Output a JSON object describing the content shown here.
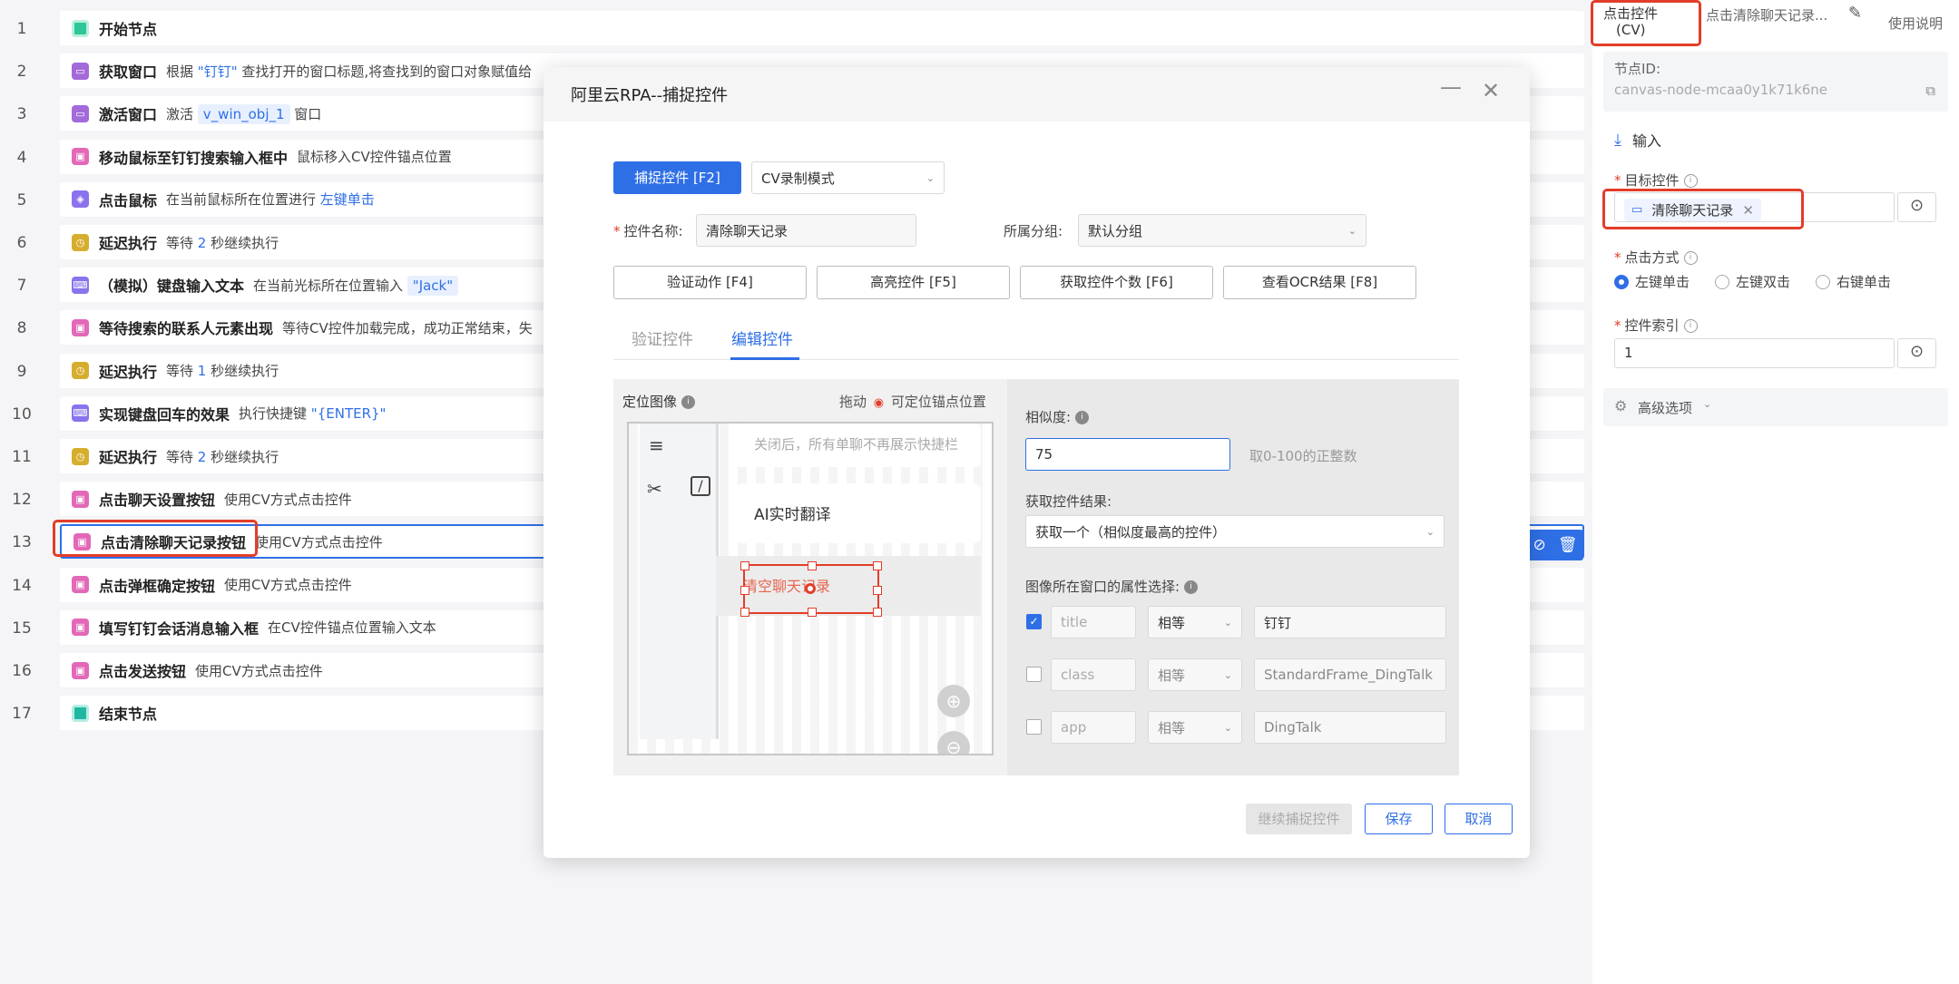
{
  "flow": {
    "steps": [
      {
        "num": "1",
        "icon": "start-node-icon",
        "title": "开始节点",
        "desc": []
      },
      {
        "num": "2",
        "icon": "window-icon",
        "title": "获取窗口",
        "desc": [
          {
            "t": "根据 "
          },
          {
            "t": "\"钉钉\"",
            "c": "hl"
          },
          {
            "t": " 查找打开的窗口标题,将查找到的窗口对象赋值给"
          }
        ]
      },
      {
        "num": "3",
        "icon": "window-icon",
        "title": "激活窗口",
        "desc": [
          {
            "t": "激活 "
          },
          {
            "t": "v_win_obj_1",
            "c": "tag"
          },
          {
            "t": " 窗口"
          }
        ]
      },
      {
        "num": "4",
        "icon": "image-icon",
        "title": "移动鼠标至钉钉搜索输入框中",
        "desc": [
          {
            "t": "鼠标移入CV控件锚点位置"
          }
        ]
      },
      {
        "num": "5",
        "icon": "mouse-icon",
        "title": "点击鼠标",
        "desc": [
          {
            "t": "在当前鼠标所在位置进行 "
          },
          {
            "t": "左键单击",
            "c": "hl"
          }
        ]
      },
      {
        "num": "6",
        "icon": "delay-icon",
        "title": "延迟执行",
        "desc": [
          {
            "t": "等待 "
          },
          {
            "t": "2",
            "c": "hl"
          },
          {
            "t": " 秒继续执行"
          }
        ]
      },
      {
        "num": "7",
        "icon": "keyboard-icon",
        "title": "（模拟）键盘输入文本",
        "desc": [
          {
            "t": "在当前光标所在位置输入 "
          },
          {
            "t": "\"Jack\"",
            "c": "tag"
          }
        ]
      },
      {
        "num": "8",
        "icon": "image-icon",
        "title": "等待搜索的联系人元素出现",
        "desc": [
          {
            "t": "等待CV控件加载完成，成功正常结束，失"
          }
        ]
      },
      {
        "num": "9",
        "icon": "delay-icon",
        "title": "延迟执行",
        "desc": [
          {
            "t": "等待 "
          },
          {
            "t": "1",
            "c": "hl"
          },
          {
            "t": " 秒继续执行"
          }
        ]
      },
      {
        "num": "10",
        "icon": "keyboard-icon",
        "title": "实现键盘回车的效果",
        "desc": [
          {
            "t": "执行快捷键 "
          },
          {
            "t": "\"{ENTER}\"",
            "c": "hl"
          }
        ]
      },
      {
        "num": "11",
        "icon": "delay-icon",
        "title": "延迟执行",
        "desc": [
          {
            "t": "等待 "
          },
          {
            "t": "2",
            "c": "hl"
          },
          {
            "t": " 秒继续执行"
          }
        ]
      },
      {
        "num": "12",
        "icon": "image-icon",
        "title": "点击聊天设置按钮",
        "desc": [
          {
            "t": "使用CV方式点击控件"
          }
        ]
      },
      {
        "num": "13",
        "icon": "image-icon",
        "title": "点击清除聊天记录按钮",
        "desc": [
          {
            "t": "使用CV方式点击控件"
          }
        ],
        "selected": true
      },
      {
        "num": "14",
        "icon": "image-icon",
        "title": "点击弹框确定按钮",
        "desc": [
          {
            "t": "使用CV方式点击控件"
          }
        ]
      },
      {
        "num": "15",
        "icon": "image-icon",
        "title": "填写钉钉会话消息输入框",
        "desc": [
          {
            "t": "在CV控件锚点位置输入文本"
          }
        ]
      },
      {
        "num": "16",
        "icon": "image-icon",
        "title": "点击发送按钮",
        "desc": [
          {
            "t": "使用CV方式点击控件"
          }
        ]
      },
      {
        "num": "17",
        "icon": "end-node-icon",
        "title": "结束节点",
        "desc": []
      }
    ]
  },
  "panel": {
    "tab_cv": "点击控件",
    "tab_cv2": "(CV)",
    "tab_name": "点击清除聊天记录...",
    "help": "使用说明",
    "node_id_label": "节点ID:",
    "node_id": "canvas-node-mcaa0y1k71k6ne",
    "input_section": "输入",
    "target_label": "目标控件",
    "target_value": "清除聊天记录",
    "click_label": "点击方式",
    "click_options": [
      "左键单击",
      "左键双击",
      "右键单击"
    ],
    "index_label": "控件索引",
    "index_value": "1",
    "advanced": "高级选项"
  },
  "modal": {
    "title": "阿里云RPA--捕捉控件",
    "capture_btn": "捕捉控件 [F2]",
    "mode": "CV录制模式",
    "name_label": "控件名称:",
    "name_value": "清除聊天记录",
    "group_label": "所属分组:",
    "group_value": "默认分组",
    "actions": [
      "验证动作 [F4]",
      "高亮控件 [F5]",
      "获取控件个数 [F6]",
      "查看OCR结果 [F8]"
    ],
    "tabs": [
      "验证控件",
      "编辑控件"
    ],
    "locate_label": "定位图像",
    "drag_hint": "拖动",
    "anchor_hint": "可定位锚点位置",
    "preview": {
      "top_text": "关闭后，所有单聊不再展示快捷栏",
      "item1": "AI实时翻译",
      "item2": "清空聊天记录"
    },
    "similarity_label": "相似度:",
    "similarity_value": "75",
    "similarity_hint": "取0-100的正整数",
    "result_label": "获取控件结果:",
    "result_value": "获取一个（相似度最高的控件）",
    "attr_label": "图像所在窗口的属性选择:",
    "attrs": [
      {
        "key": "title",
        "op": "相等",
        "value": "钉钉",
        "checked": true
      },
      {
        "key": "class",
        "op": "相等",
        "value": "StandardFrame_DingTalk",
        "checked": false
      },
      {
        "key": "app",
        "op": "相等",
        "value": "DingTalk",
        "checked": false
      }
    ],
    "continue_btn": "继续捕捉控件",
    "save_btn": "保存",
    "cancel_btn": "取消"
  }
}
